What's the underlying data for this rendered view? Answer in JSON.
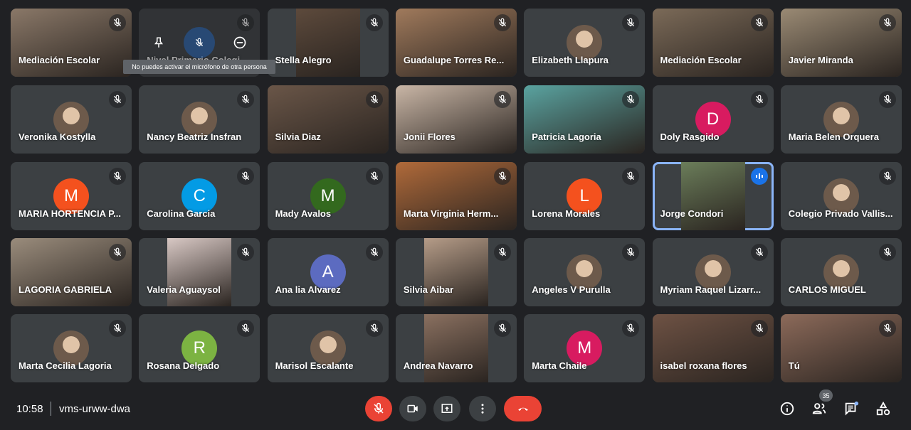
{
  "tooltip": "No puedes activar el micrófono de otra persona",
  "hovered_tile_index": 1,
  "tiles": [
    {
      "name": "Mediación Escolar",
      "type": "video",
      "color": "#8a7868"
    },
    {
      "name": "Nivel Primario Colegi...",
      "type": "hover",
      "color": "#3c4043"
    },
    {
      "name": "Stella Alegro",
      "type": "video-narrow",
      "color": "#5d4a3c"
    },
    {
      "name": "Guadalupe Torres Re...",
      "type": "video",
      "color": "#a07a5c"
    },
    {
      "name": "Elizabeth Llapura",
      "type": "photo"
    },
    {
      "name": "Mediación Escolar",
      "type": "video",
      "color": "#7b6a58"
    },
    {
      "name": "Javier Miranda",
      "type": "video",
      "color": "#9a8a74"
    },
    {
      "name": "Veronika Kostylla",
      "type": "photo"
    },
    {
      "name": "Nancy Beatriz Insfran",
      "type": "photo"
    },
    {
      "name": "Silvia Diaz",
      "type": "video",
      "color": "#6a5648"
    },
    {
      "name": "Jonii Flores",
      "type": "video",
      "color": "#c9b6a6"
    },
    {
      "name": "Patricia Lagoria",
      "type": "video",
      "color": "#5aa3a0"
    },
    {
      "name": "Doly Rasgido",
      "type": "avatar",
      "letter": "D",
      "color": "#d81b60"
    },
    {
      "name": "Maria Belen Orquera",
      "type": "photo"
    },
    {
      "name": "MARIA HORTENCIA P...",
      "type": "avatar",
      "letter": "M",
      "color": "#f4511e"
    },
    {
      "name": "Carolina Garcia",
      "type": "avatar",
      "letter": "C",
      "color": "#039be5"
    },
    {
      "name": "Mady Avalos",
      "type": "avatar",
      "letter": "M",
      "color": "#33691e"
    },
    {
      "name": "Marta Virginia Herm...",
      "type": "video",
      "color": "#b06a3a"
    },
    {
      "name": "Lorena Morales",
      "type": "avatar",
      "letter": "L",
      "color": "#f4511e"
    },
    {
      "name": "Jorge Condori",
      "type": "video-narrow",
      "color": "#6b7d5a",
      "speaking": true
    },
    {
      "name": "Colegio Privado Vallis...",
      "type": "photo"
    },
    {
      "name": "LAGORIA GABRIELA",
      "type": "video",
      "color": "#9a8c7c"
    },
    {
      "name": "Valeria Aguaysol",
      "type": "video-narrow",
      "color": "#d8c8c4"
    },
    {
      "name": "Ana lia Alvarez",
      "type": "avatar",
      "letter": "A",
      "color": "#5c6bc0"
    },
    {
      "name": "Silvia Aibar",
      "type": "video-narrow",
      "color": "#b59c88"
    },
    {
      "name": "Angeles V Purulla",
      "type": "photo"
    },
    {
      "name": "Myriam Raquel Lizarr...",
      "type": "photo"
    },
    {
      "name": "CARLOS MIGUEL",
      "type": "photo"
    },
    {
      "name": "Marta Cecilia Lagoria",
      "type": "photo"
    },
    {
      "name": "Rosana Delgado",
      "type": "avatar",
      "letter": "R",
      "color": "#7cb342"
    },
    {
      "name": "Marisol Escalante",
      "type": "photo"
    },
    {
      "name": "Andrea Navarro",
      "type": "video-narrow",
      "color": "#8a7060"
    },
    {
      "name": "Marta Chaile",
      "type": "avatar",
      "letter": "M",
      "color": "#d81b60"
    },
    {
      "name": "isabel roxana flores",
      "type": "video",
      "color": "#6e5244"
    },
    {
      "name": "Tú",
      "type": "video",
      "color": "#8c6a5a"
    }
  ],
  "bottom": {
    "time": "10:58",
    "meeting_code": "vms-urww-dwa",
    "participant_count": "35"
  },
  "colors": {
    "background": "#202124",
    "tile": "#3c4043",
    "danger": "#ea4335",
    "accent": "#8ab4f8"
  }
}
